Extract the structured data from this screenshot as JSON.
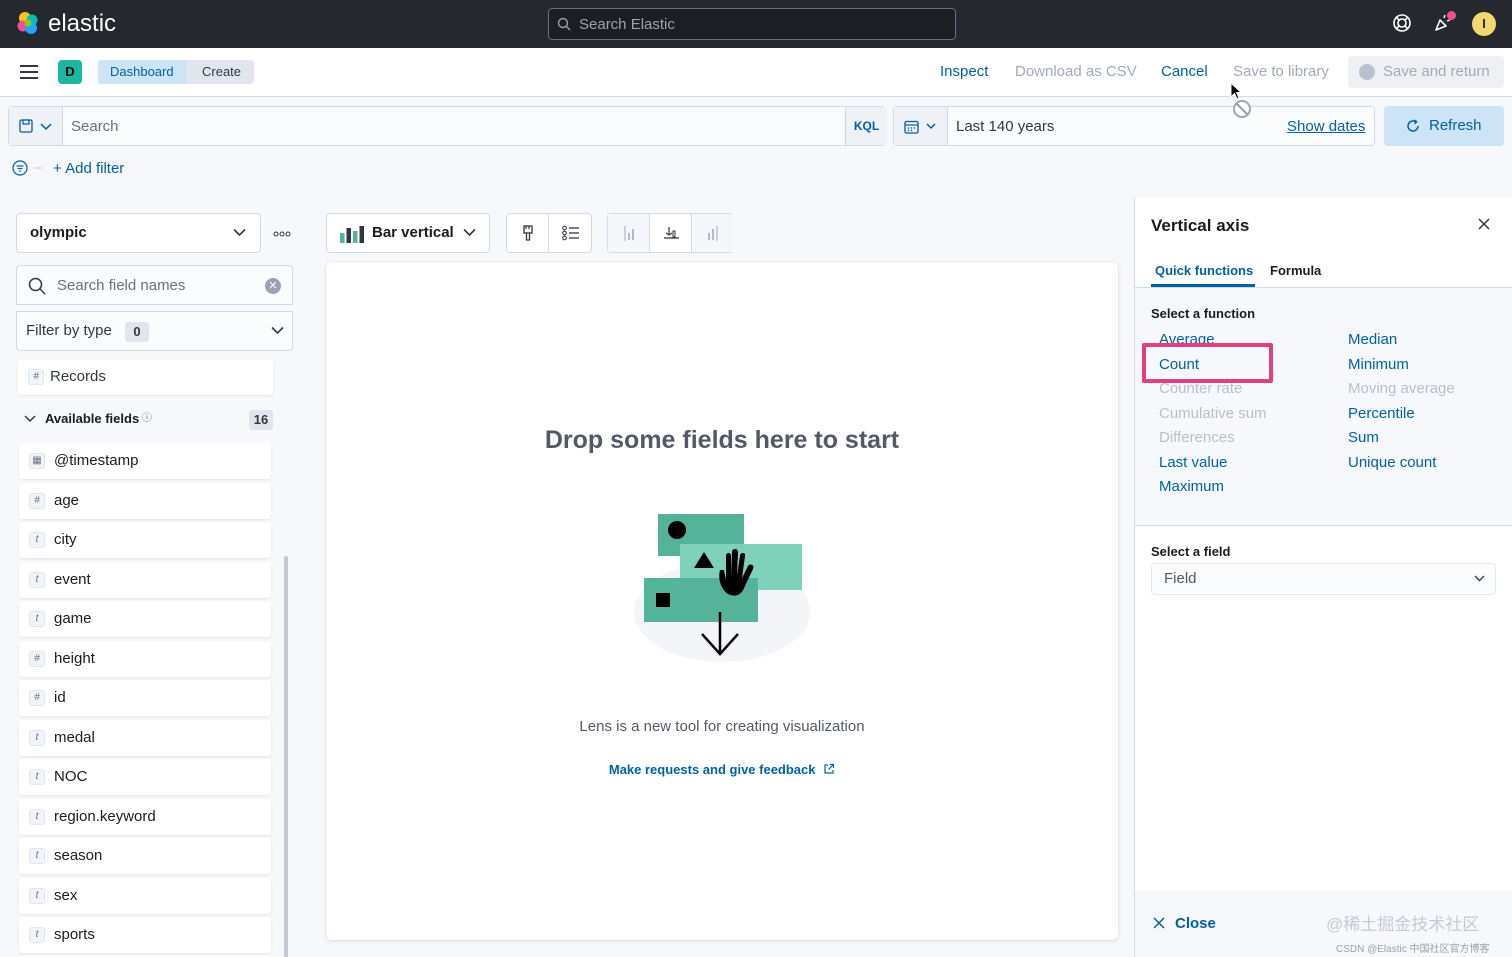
{
  "header": {
    "brand": "elastic",
    "search_placeholder": "Search Elastic",
    "avatar_initial": "I"
  },
  "appbar": {
    "space_initial": "D",
    "breadcrumbs": [
      "Dashboard",
      "Create"
    ],
    "inspect": "Inspect",
    "download_csv": "Download as CSV",
    "cancel": "Cancel",
    "save_library": "Save to library",
    "save_return": "Save and return"
  },
  "query": {
    "placeholder": "Search",
    "language": "KQL",
    "date_range": "Last 140 years",
    "show_dates": "Show dates",
    "refresh": "Refresh",
    "add_filter": "+ Add filter"
  },
  "sidebar": {
    "index_pattern": "olympic",
    "field_search_placeholder": "Search field names",
    "filter_by_type": "Filter by type",
    "filter_count": "0",
    "records": "Records",
    "available_fields_label": "Available fields",
    "available_fields_count": "16",
    "fields": [
      {
        "name": "@timestamp",
        "type": "date"
      },
      {
        "name": "age",
        "type": "#"
      },
      {
        "name": "city",
        "type": "t"
      },
      {
        "name": "event",
        "type": "t"
      },
      {
        "name": "game",
        "type": "t"
      },
      {
        "name": "height",
        "type": "#"
      },
      {
        "name": "id",
        "type": "#"
      },
      {
        "name": "medal",
        "type": "t"
      },
      {
        "name": "NOC",
        "type": "t"
      },
      {
        "name": "region.keyword",
        "type": "t"
      },
      {
        "name": "season",
        "type": "t"
      },
      {
        "name": "sex",
        "type": "t"
      },
      {
        "name": "sports",
        "type": "t"
      }
    ]
  },
  "toolbar": {
    "chart_type": "Bar vertical"
  },
  "workspace": {
    "drop_title": "Drop some fields here to start",
    "description": "Lens is a new tool for creating visualization",
    "feedback_link": "Make requests and give feedback"
  },
  "flyout": {
    "title": "Vertical axis",
    "tabs": [
      "Quick functions",
      "Formula"
    ],
    "select_function_label": "Select a function",
    "functions_left": [
      {
        "label": "Average",
        "enabled": true
      },
      {
        "label": "Count",
        "enabled": true
      },
      {
        "label": "Counter rate",
        "enabled": false
      },
      {
        "label": "Cumulative sum",
        "enabled": false
      },
      {
        "label": "Differences",
        "enabled": false
      },
      {
        "label": "Last value",
        "enabled": true
      },
      {
        "label": "Maximum",
        "enabled": true
      }
    ],
    "functions_right": [
      {
        "label": "Median",
        "enabled": true
      },
      {
        "label": "Minimum",
        "enabled": true
      },
      {
        "label": "Moving average",
        "enabled": false
      },
      {
        "label": "Percentile",
        "enabled": true
      },
      {
        "label": "Sum",
        "enabled": true
      },
      {
        "label": "Unique count",
        "enabled": true
      }
    ],
    "highlighted_function": "Count",
    "select_field_label": "Select a field",
    "field_placeholder": "Field",
    "close": "Close"
  },
  "watermark": {
    "line1": "@稀土掘金技术社区",
    "line2": "CSDN @Elastic 中国社区官方博客"
  },
  "colors": {
    "header_bg": "#25282f",
    "link_blue": "#0061a6",
    "accent_teal": "#1bb7a0",
    "highlight_pink": "#e0407f"
  }
}
